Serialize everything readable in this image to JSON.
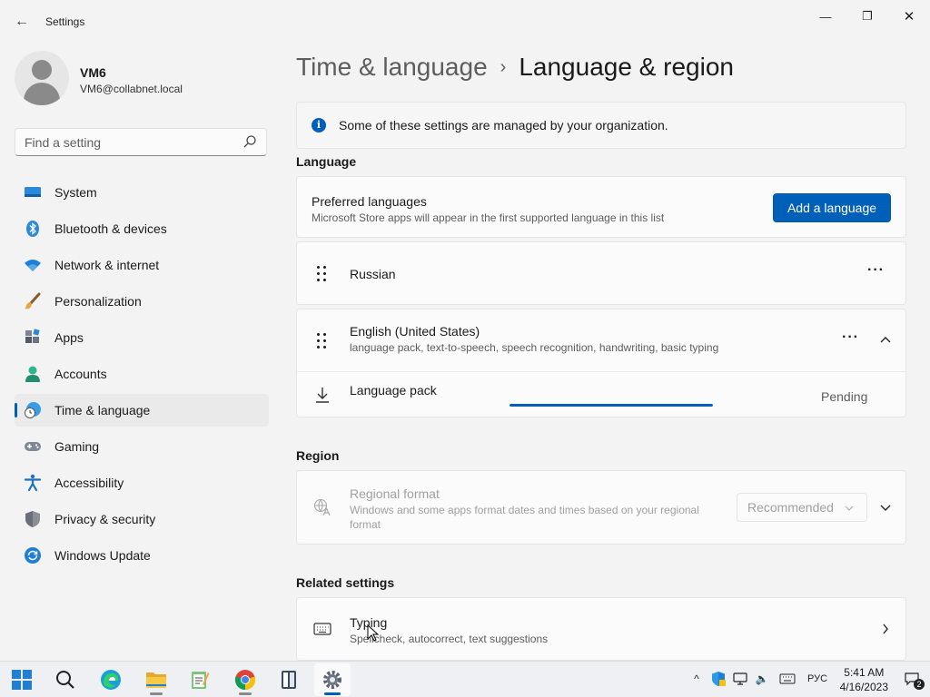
{
  "window": {
    "title": "Settings",
    "minimize_glyph": "—",
    "maximize_glyph": "❐",
    "close_glyph": "✕"
  },
  "user": {
    "name": "VM6",
    "email": "VM6@collabnet.local"
  },
  "search": {
    "placeholder": "Find a setting"
  },
  "sidebar": {
    "items": [
      {
        "label": "System",
        "icon": "system-icon"
      },
      {
        "label": "Bluetooth & devices",
        "icon": "bluetooth-icon"
      },
      {
        "label": "Network & internet",
        "icon": "wifi-icon"
      },
      {
        "label": "Personalization",
        "icon": "brush-icon"
      },
      {
        "label": "Apps",
        "icon": "apps-icon"
      },
      {
        "label": "Accounts",
        "icon": "accounts-icon"
      },
      {
        "label": "Time & language",
        "icon": "time-language-icon",
        "active": true
      },
      {
        "label": "Gaming",
        "icon": "gamepad-icon"
      },
      {
        "label": "Accessibility",
        "icon": "accessibility-icon"
      },
      {
        "label": "Privacy & security",
        "icon": "shield-icon"
      },
      {
        "label": "Windows Update",
        "icon": "update-icon"
      }
    ]
  },
  "breadcrumb": {
    "parent": "Time & language",
    "separator": "›",
    "current": "Language & region"
  },
  "info_bar": {
    "text": "Some of these settings are managed by your organization.",
    "icon_glyph": "i"
  },
  "language_section": {
    "heading": "Language",
    "preferred": {
      "title": "Preferred languages",
      "subtitle": "Microsoft Store apps will appear in the first supported language in this list",
      "add_button": "Add a language"
    },
    "languages": [
      {
        "name": "Russian",
        "more_glyph": "···"
      },
      {
        "name": "English (United States)",
        "features": "language pack, text-to-speech, speech recognition, handwriting, basic typing",
        "more_glyph": "···",
        "download": {
          "label": "Language pack",
          "status": "Pending",
          "progress_pct": 100
        }
      }
    ]
  },
  "region_section": {
    "heading": "Region",
    "regional_format": {
      "title": "Regional format",
      "subtitle": "Windows and some apps format dates and times based on your regional format",
      "value": "Recommended"
    }
  },
  "related_section": {
    "heading": "Related settings",
    "typing": {
      "title": "Typing",
      "subtitle": "Spellcheck, autocorrect, text suggestions"
    }
  },
  "taskbar": {
    "apps": [
      "start",
      "search",
      "edge",
      "file-explorer",
      "notepad",
      "chrome",
      "reader",
      "settings"
    ],
    "tray": {
      "chevron_glyph": "^",
      "volume_glyph": "🔈",
      "input_language": "РУС",
      "time": "5:41 AM",
      "date": "4/16/2023",
      "notification_count": "2"
    }
  },
  "colors": {
    "accent": "#005fb8",
    "background": "#f3f3f3",
    "card": "#fbfbfb"
  }
}
